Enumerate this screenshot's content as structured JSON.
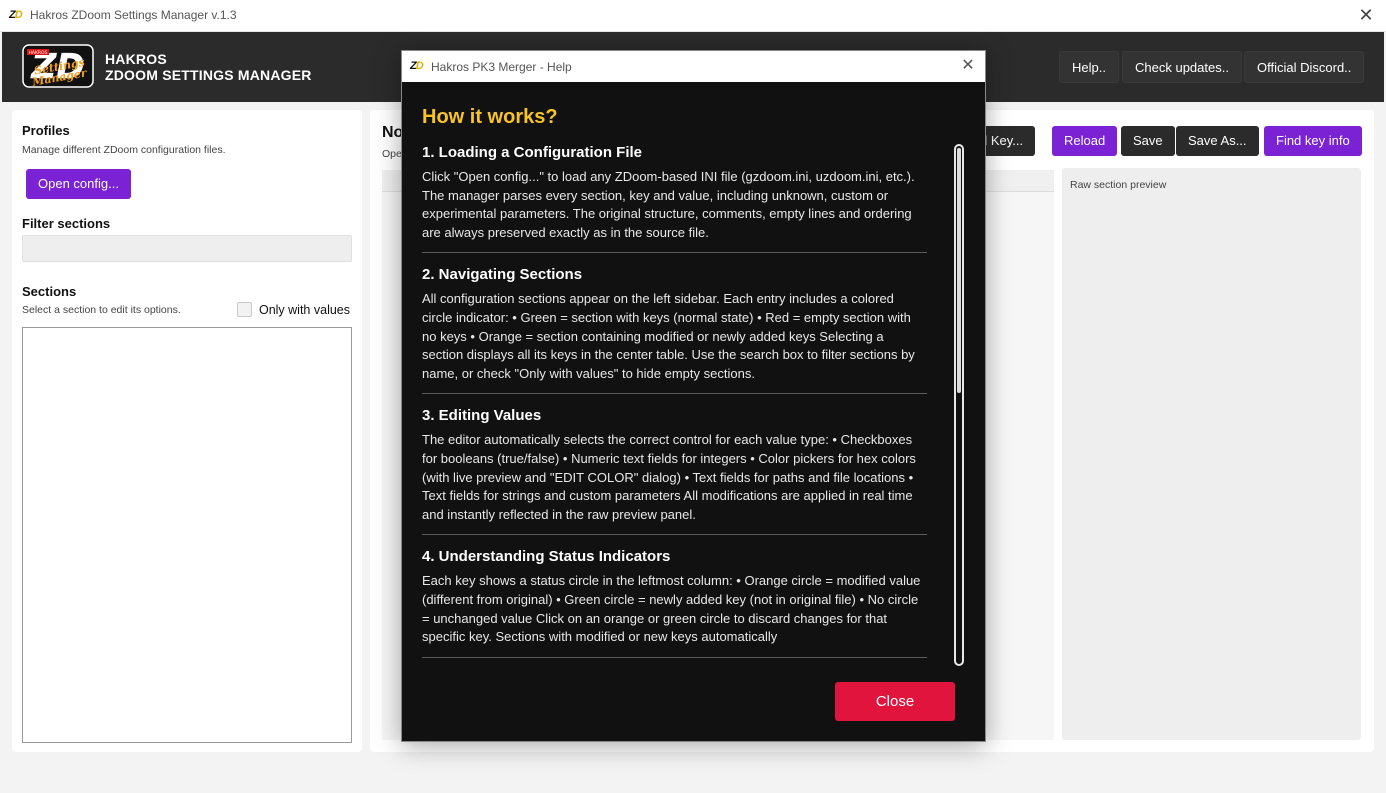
{
  "window": {
    "title": "Hakros ZDoom Settings Manager v.1.3",
    "icon_text": "ZD",
    "close_glyph": "✕"
  },
  "header": {
    "logo_lines": [
      "HAKROS",
      "Settings",
      "Manager"
    ],
    "brand_line1": "HAKROS",
    "brand_line2": "ZDOOM SETTINGS MANAGER",
    "buttons": {
      "help": "Help..",
      "updates": "Check updates..",
      "discord": "Official Discord.."
    }
  },
  "left_panel": {
    "profiles_title": "Profiles",
    "profiles_sub": "Manage different ZDoom configuration files.",
    "open_config": "Open config...",
    "filter_title": "Filter sections",
    "filter_value": "",
    "sections_title": "Sections",
    "sections_sub": "Select a section to edit its options.",
    "only_values_label": "Only with values"
  },
  "center_panel": {
    "title_partial": "No",
    "sub_partial": "Ope",
    "toolbar": {
      "add_key_partial": "d Key...",
      "reload": "Reload",
      "save": "Save",
      "save_as": "Save As...",
      "find_key_info": "Find key info"
    },
    "preview_label": "Raw section preview"
  },
  "colors": {
    "header_bg": "#2b2b2b",
    "accent_purple": "#7a22d4",
    "heading_yellow": "#f7c325",
    "close_red": "#e0143c",
    "modal_bg": "#111111"
  },
  "help_modal": {
    "title": "Hakros PK3 Merger - Help",
    "icon_text": "ZD",
    "close_glyph": "✕",
    "heading": "How it works?",
    "sections": [
      {
        "title": "1. Loading a Configuration File",
        "body": "Click \"Open config...\" to load any ZDoom-based INI file (gzdoom.ini, uzdoom.ini, etc.). The manager parses every section, key and value, including unknown, custom or experimental parameters. The original structure, comments, empty lines and ordering are always preserved exactly as in the source file."
      },
      {
        "title": "2. Navigating Sections",
        "body": "All configuration sections appear on the left sidebar. Each entry includes a colored circle indicator: • Green = section with keys (normal state) • Red = empty section with no keys • Orange = section containing modified or newly added keys Selecting a section displays all its keys in the center table. Use the search box to filter sections by name, or check \"Only with values\" to hide empty sections."
      },
      {
        "title": "3. Editing Values",
        "body": "The editor automatically selects the correct control for each value type: • Checkboxes for booleans (true/false) • Numeric text fields for integers • Color pickers for hex colors (with live preview and \"EDIT COLOR\" dialog) • Text fields for paths and file locations • Text fields for strings and custom parameters All modifications are applied in real time and instantly reflected in the raw preview panel."
      },
      {
        "title": "4. Understanding Status Indicators",
        "body": "Each key shows a status circle in the leftmost column: • Orange circle = modified value (different from original) • Green circle = newly added key (not in original file) • No circle = unchanged value Click on an orange or green circle to discard changes for that specific key. Sections with modified or new keys automatically"
      }
    ],
    "close_label": "Close"
  }
}
